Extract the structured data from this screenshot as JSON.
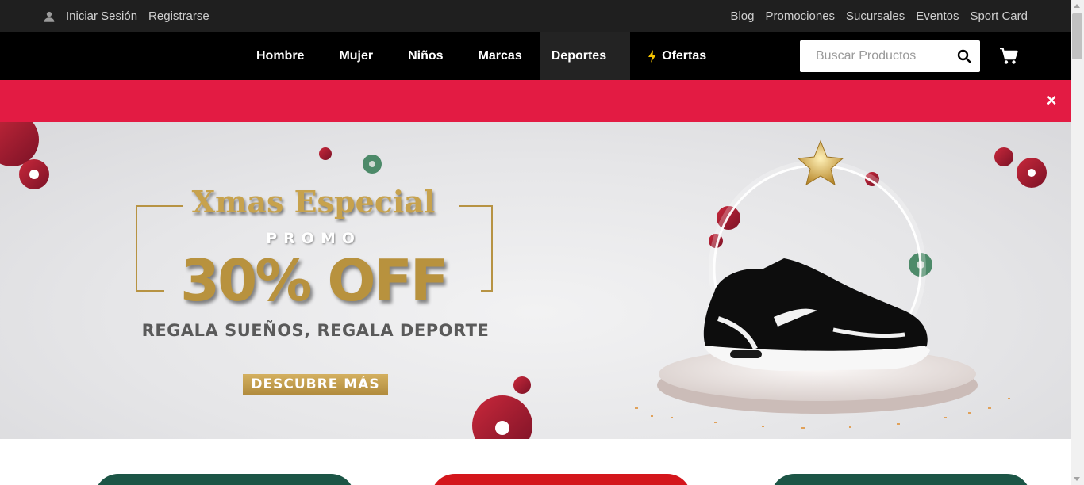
{
  "topbar": {
    "login_label": "Iniciar Sesión",
    "register_label": "Registrarse",
    "links": [
      "Blog",
      "Promociones",
      "Sucursales",
      "Eventos",
      "Sport Card"
    ]
  },
  "nav": {
    "items": [
      "Hombre",
      "Mujer",
      "Niños",
      "Marcas",
      "Deportes",
      "Ofertas"
    ],
    "active": "Deportes",
    "search_placeholder": "Buscar Productos"
  },
  "notice": {
    "close_symbol": "×"
  },
  "hero": {
    "title": "Xmas Especial",
    "promo": "PROMO",
    "discount": "30% OFF",
    "tagline": "REGALA SUEÑOS, REGALA DEPORTE",
    "cta": "DESCUBRE MÁS"
  },
  "colors": {
    "topbar_bg": "#1f1f1f",
    "nav_bg": "#000000",
    "notice_bg": "#e31b43",
    "gold": "#c7a24d",
    "card_green": "#1c5546",
    "card_red": "#d4161c"
  },
  "icons": [
    "user-icon",
    "search-icon",
    "cart-icon",
    "close-icon",
    "bolt-icon"
  ]
}
